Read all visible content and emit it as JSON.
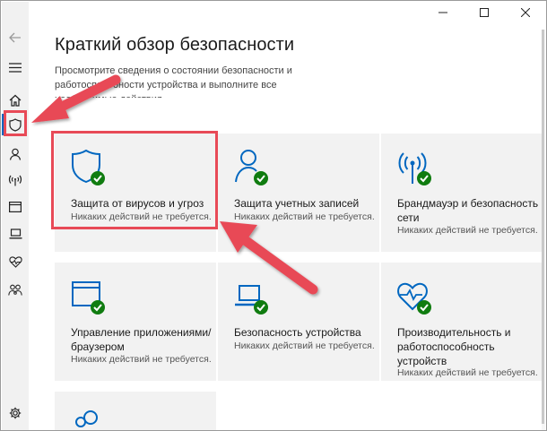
{
  "window": {
    "controls": [
      "minimize",
      "maximize",
      "close"
    ]
  },
  "sidebar": {
    "items": [
      {
        "icon": "back-arrow-icon"
      },
      {
        "icon": "hamburger-menu-icon"
      },
      {
        "icon": "home-icon"
      },
      {
        "icon": "shield-icon",
        "active": true
      },
      {
        "icon": "account-icon"
      },
      {
        "icon": "wifi-signal-icon"
      },
      {
        "icon": "app-browser-icon"
      },
      {
        "icon": "laptop-icon"
      },
      {
        "icon": "heart-pulse-icon"
      },
      {
        "icon": "family-icon"
      },
      {
        "icon": "settings-gear-icon"
      }
    ]
  },
  "page": {
    "title": "Краткий обзор безопасности",
    "description": "Просмотрите сведения о состоянии безопасности и работоспособности устройства и выполните все необходимые действия."
  },
  "tiles": [
    {
      "name": "Защита от вирусов и угроз",
      "status": "Никаких действий не требуется.",
      "icon": "virus-shield-icon"
    },
    {
      "name": "Защита учетных записей",
      "status": "Никаких действий не требуется.",
      "icon": "account-protection-icon"
    },
    {
      "name": "Брандмауэр и безопасность сети",
      "status": "Никаких действий не требуется.",
      "icon": "firewall-network-icon"
    },
    {
      "name": "Управление приложениями/браузером",
      "status": "Никаких действий не требуется.",
      "icon": "app-browser-control-icon"
    },
    {
      "name": "Безопасность устройства",
      "status": "Никаких действий не требуется.",
      "icon": "device-security-icon"
    },
    {
      "name": "Производительность и работоспособность устройств",
      "status": "Никаких действий не требуется.",
      "icon": "device-performance-icon"
    },
    {
      "name": "",
      "status": "",
      "icon": "family-options-icon"
    }
  ],
  "colors": {
    "accent": "#0067c0",
    "ok": "#107c10",
    "highlight": "#e84a57",
    "tile_bg": "#f2f2f2",
    "sidebar_bg": "#f1f1f1"
  }
}
